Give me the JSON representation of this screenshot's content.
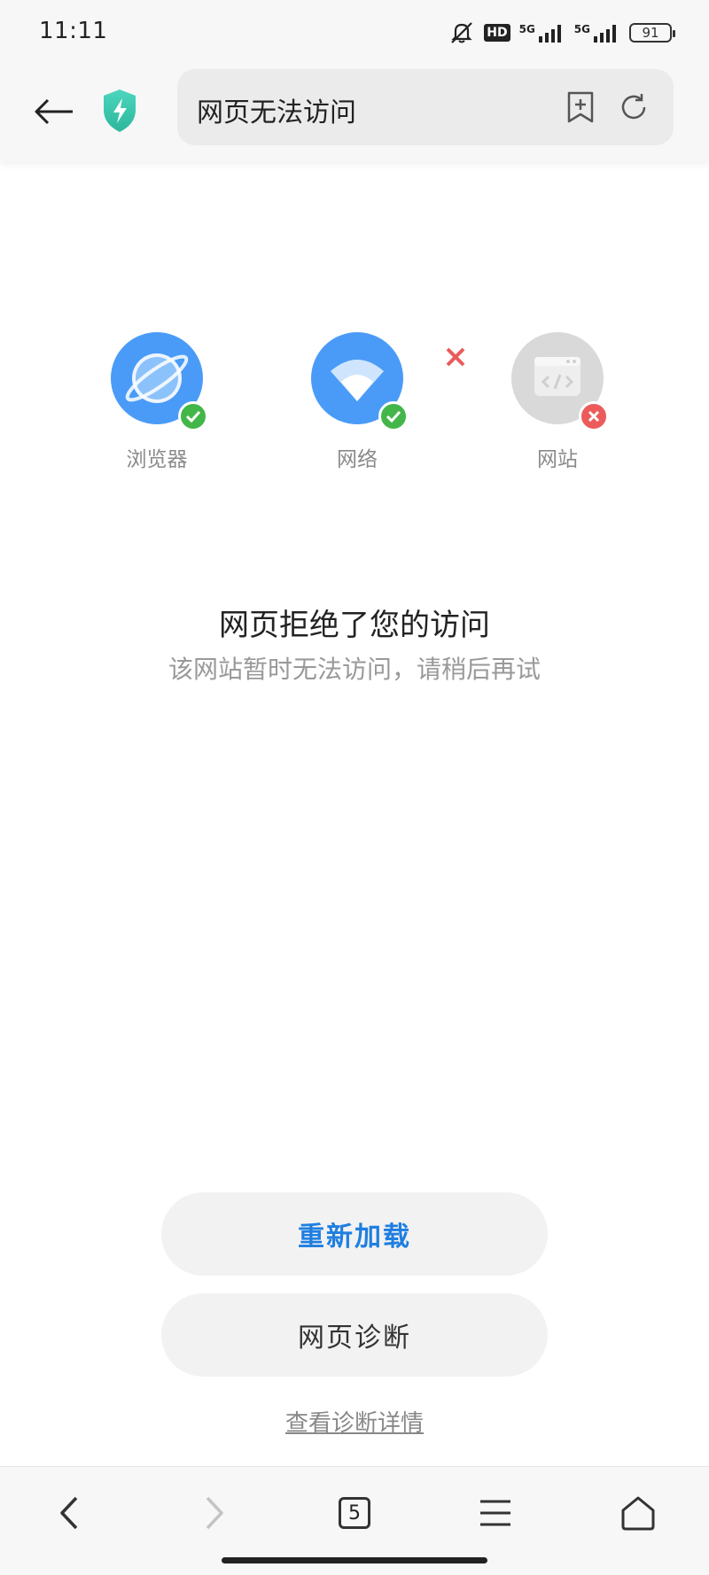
{
  "status_bar": {
    "time": "11:11",
    "network_1": "5G",
    "network_2": "5G",
    "hd_label": "HD",
    "battery": "91"
  },
  "toolbar": {
    "page_title": "网页无法访问",
    "icons": [
      "back-arrow-icon",
      "shield-icon",
      "bookmark-add-icon",
      "refresh-icon"
    ]
  },
  "diagnostics": {
    "items": [
      {
        "label": "浏览器",
        "status": "ok",
        "icon": "browser-planet-icon"
      },
      {
        "label": "网络",
        "status": "ok",
        "icon": "wifi-icon"
      },
      {
        "label": "网站",
        "status": "error",
        "icon": "code-window-icon"
      }
    ]
  },
  "message": {
    "title": "网页拒绝了您的访问",
    "subtitle": "该网站暂时无法访问，请稍后再试"
  },
  "actions": {
    "reload_label": "重新加载",
    "diagnose_label": "网页诊断",
    "details_link": "查看诊断详情"
  },
  "bottom_nav": {
    "tab_count": "5",
    "items": [
      "back-icon",
      "forward-icon",
      "tabs-icon",
      "menu-icon",
      "home-icon"
    ]
  },
  "colors": {
    "accent_blue": "#1f7fe0",
    "icon_blue": "#4a9bf7",
    "ok_green": "#43b649",
    "error_red": "#ec5b5b",
    "shield_teal": "#35c9b0"
  }
}
